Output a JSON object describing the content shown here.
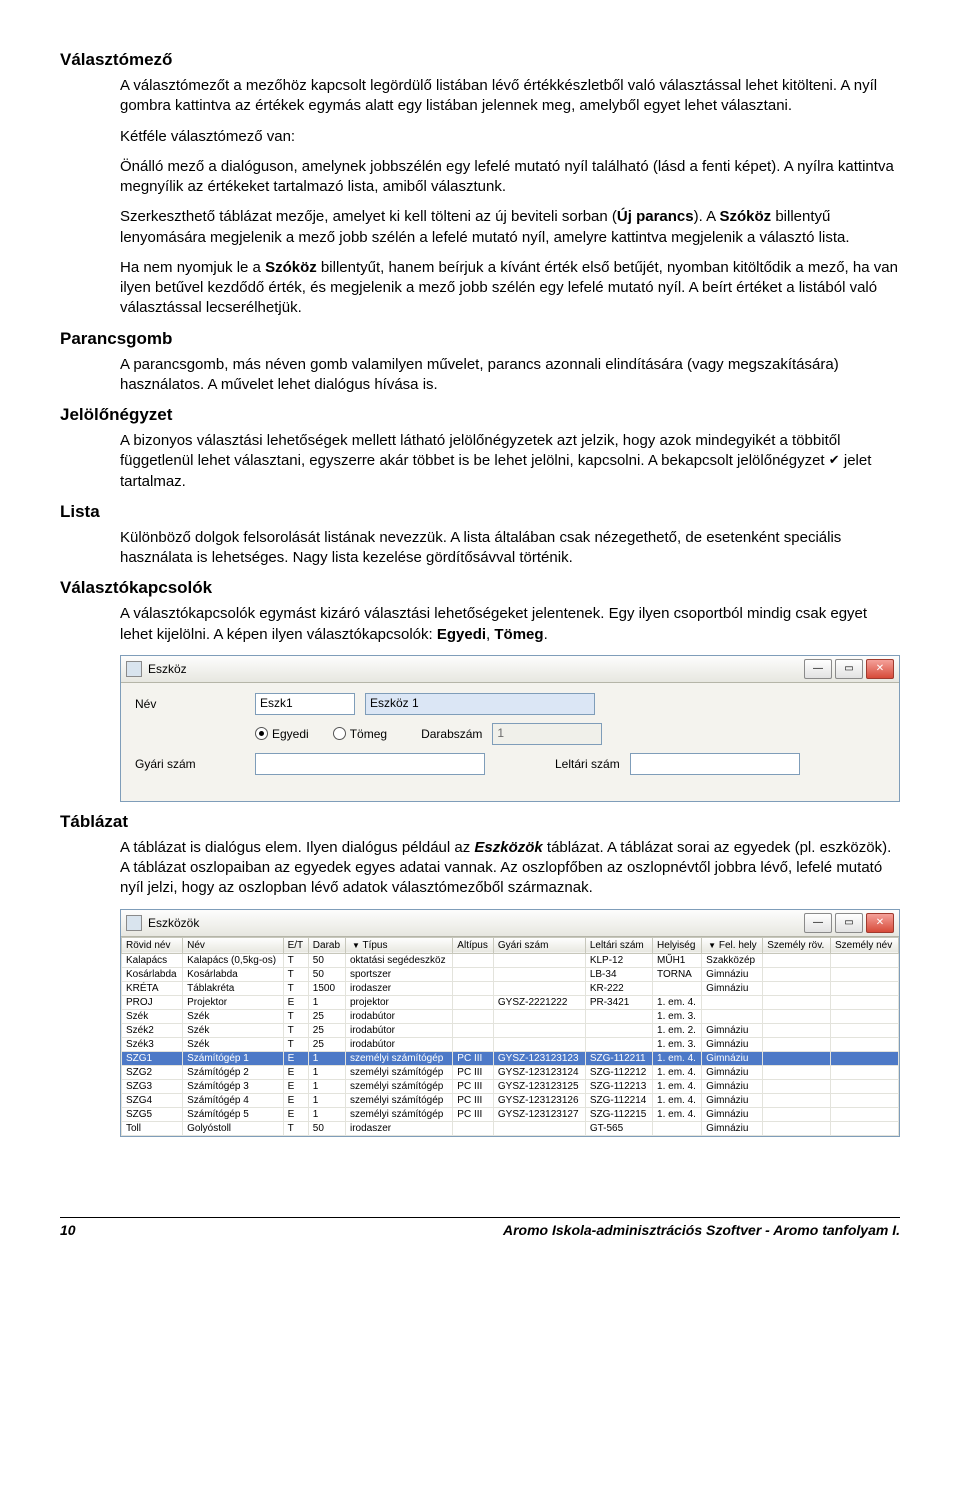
{
  "sections": {
    "valasztomezo": {
      "title": "Választómező",
      "p1": "A választómezőt a mezőhöz kapcsolt legördülő listában lévő értékkészletből való választással lehet kitölteni. A nyíl gombra kattintva az értékek egymás alatt egy listában jelennek meg, amelyből egyet lehet választani.",
      "p2": "Kétféle választómező van:",
      "p3": "Önálló mező a dialóguson, amelynek jobbszélén egy lefelé mutató nyíl található (lásd a fenti képet). A nyílra kattintva megnyílik az értékeket tartalmazó lista, amiből választunk.",
      "p4a": "Szerkeszthető táblázat mezője, amelyet ki kell tölteni az új beviteli sorban (",
      "p4_uj": "Új parancs",
      "p4b": "). A ",
      "p4_szokoz": "Szóköz",
      "p4c": " billentyű lenyomására megjelenik a mező jobb szélén a lefelé mutató nyíl, amelyre kattintva megjelenik a választó lista.",
      "p5a": "Ha nem nyomjuk le a ",
      "p5_szokoz": "Szóköz",
      "p5b": " billentyűt, hanem beírjuk a kívánt érték első betűjét, nyomban kitöltődik a mező, ha van ilyen betűvel kezdődő érték, és megjelenik a mező jobb szélén egy lefelé mutató nyíl. A beírt értéket a listából való választással lecserélhetjük."
    },
    "parancsgomb": {
      "title": "Parancsgomb",
      "p1": "A parancsgomb, más néven gomb valamilyen művelet, parancs azonnali elindítására (vagy megszakítására) használatos. A művelet lehet dialógus hívása is."
    },
    "jelolo": {
      "title": "Jelölőnégyzet",
      "p1a": "A bizonyos választási lehetőségek mellett látható jelölőnégyzetek azt jelzik, hogy azok mindegyikét a többitől függetlenül lehet választani, egyszerre akár többet is be lehet jelölni, kapcsolni. A bekapcsolt jelölőnégyzet ",
      "p1b": " jelet tartalmaz."
    },
    "lista": {
      "title": "Lista",
      "p1": "Különböző dolgok felsorolását listának nevezzük. A lista általában csak nézegethető, de esetenként speciális használata is lehetséges. Nagy lista kezelése gördítősávval történik."
    },
    "valkapcs": {
      "title": "Választókapcsolók",
      "p1a": "A választókapcsolók egymást kizáró választási lehetőségeket jelentenek. Egy ilyen csoportból mindig csak egyet lehet kijelölni. A képen ilyen választókapcsolók: ",
      "p1_b1": "Egyedi",
      "p1_mid": ", ",
      "p1_b2": "Tömeg",
      "p1_end": "."
    },
    "tablazat": {
      "title": "Táblázat",
      "p1a": "A táblázat is dialógus elem. Ilyen dialógus például az ",
      "p1_eszkozok": "Eszközök",
      "p1b": " táblázat. A táblázat sorai az egyedek (pl. eszközök). A táblázat oszlopaiban az egyedek egyes adatai vannak. Az oszlopfőben az oszlopnévtől jobbra lévő, lefelé mutató nyíl jelzi, hogy az oszlopban lévő adatok választómezőből származnak."
    }
  },
  "dialog1": {
    "title": "Eszköz",
    "labels": {
      "nev": "Név",
      "gyari": "Gyári szám",
      "darab": "Darabszám",
      "leltari": "Leltári szám"
    },
    "values": {
      "nev_short": "Eszk1",
      "nev_long": "Eszköz 1",
      "darab": "1"
    },
    "radios": {
      "egyedi": "Egyedi",
      "tomeg": "Tömeg"
    }
  },
  "dialog2": {
    "title": "Eszközök",
    "headers": [
      "Rövid név",
      "Név",
      "E/T",
      "Darab",
      "Típus",
      "Altípus",
      "Gyári szám",
      "Leltári szám",
      "Helyiség",
      "Fel. hely",
      "Személy röv.",
      "Személy név"
    ],
    "sort_col": 4,
    "sort_felhely": 9,
    "rows": [
      {
        "c": [
          "Kalapács",
          "Kalapács (0,5kg-os)",
          "T",
          "50",
          "oktatási segédeszköz",
          "",
          "",
          "KLP-12",
          "MŰH1",
          "Szakközép",
          "",
          ""
        ]
      },
      {
        "c": [
          "Kosárlabda",
          "Kosárlabda",
          "T",
          "50",
          "sportszer",
          "",
          "",
          "LB-34",
          "TORNA",
          "Gimnáziu",
          "",
          ""
        ]
      },
      {
        "c": [
          "KRÉTA",
          "Táblakréta",
          "T",
          "1500",
          "irodaszer",
          "",
          "",
          "KR-222",
          "",
          "Gimnáziu",
          "",
          ""
        ]
      },
      {
        "c": [
          "PROJ",
          "Projektor",
          "E",
          "1",
          "projektor",
          "",
          "GYSZ-2221222",
          "PR-3421",
          "1. em. 4.",
          "",
          "",
          ""
        ]
      },
      {
        "c": [
          "Szék",
          "Szék",
          "T",
          "25",
          "irodabútor",
          "",
          "",
          "",
          "1. em. 3.",
          "",
          "",
          ""
        ]
      },
      {
        "c": [
          "Szék2",
          "Szék",
          "T",
          "25",
          "irodabútor",
          "",
          "",
          "",
          "1. em. 2.",
          "Gimnáziu",
          "",
          ""
        ]
      },
      {
        "c": [
          "Szék3",
          "Szék",
          "T",
          "25",
          "irodabútor",
          "",
          "",
          "",
          "1. em. 3.",
          "Gimnáziu",
          "",
          ""
        ]
      },
      {
        "sel": true,
        "c": [
          "SZG1",
          "Számítógép 1",
          "E",
          "1",
          "személyi számítógép",
          "PC III",
          "GYSZ-123123123",
          "SZG-112211",
          "1. em. 4.",
          "Gimnáziu",
          "",
          ""
        ]
      },
      {
        "c": [
          "SZG2",
          "Számítógép 2",
          "E",
          "1",
          "személyi számítógép",
          "PC III",
          "GYSZ-123123124",
          "SZG-112212",
          "1. em. 4.",
          "Gimnáziu",
          "",
          ""
        ]
      },
      {
        "c": [
          "SZG3",
          "Számítógép 3",
          "E",
          "1",
          "személyi számítógép",
          "PC III",
          "GYSZ-123123125",
          "SZG-112213",
          "1. em. 4.",
          "Gimnáziu",
          "",
          ""
        ]
      },
      {
        "c": [
          "SZG4",
          "Számítógép 4",
          "E",
          "1",
          "személyi számítógép",
          "PC III",
          "GYSZ-123123126",
          "SZG-112214",
          "1. em. 4.",
          "Gimnáziu",
          "",
          ""
        ]
      },
      {
        "c": [
          "SZG5",
          "Számítógép 5",
          "E",
          "1",
          "személyi számítógép",
          "PC III",
          "GYSZ-123123127",
          "SZG-112215",
          "1. em. 4.",
          "Gimnáziu",
          "",
          ""
        ]
      },
      {
        "c": [
          "Toll",
          "Golyóstoll",
          "T",
          "50",
          "irodaszer",
          "",
          "",
          "GT-565",
          "",
          "Gimnáziu",
          "",
          ""
        ]
      }
    ]
  },
  "footer": {
    "page": "10",
    "right": "Aromo Iskola-adminisztrációs Szoftver - Aromo tanfolyam I."
  }
}
